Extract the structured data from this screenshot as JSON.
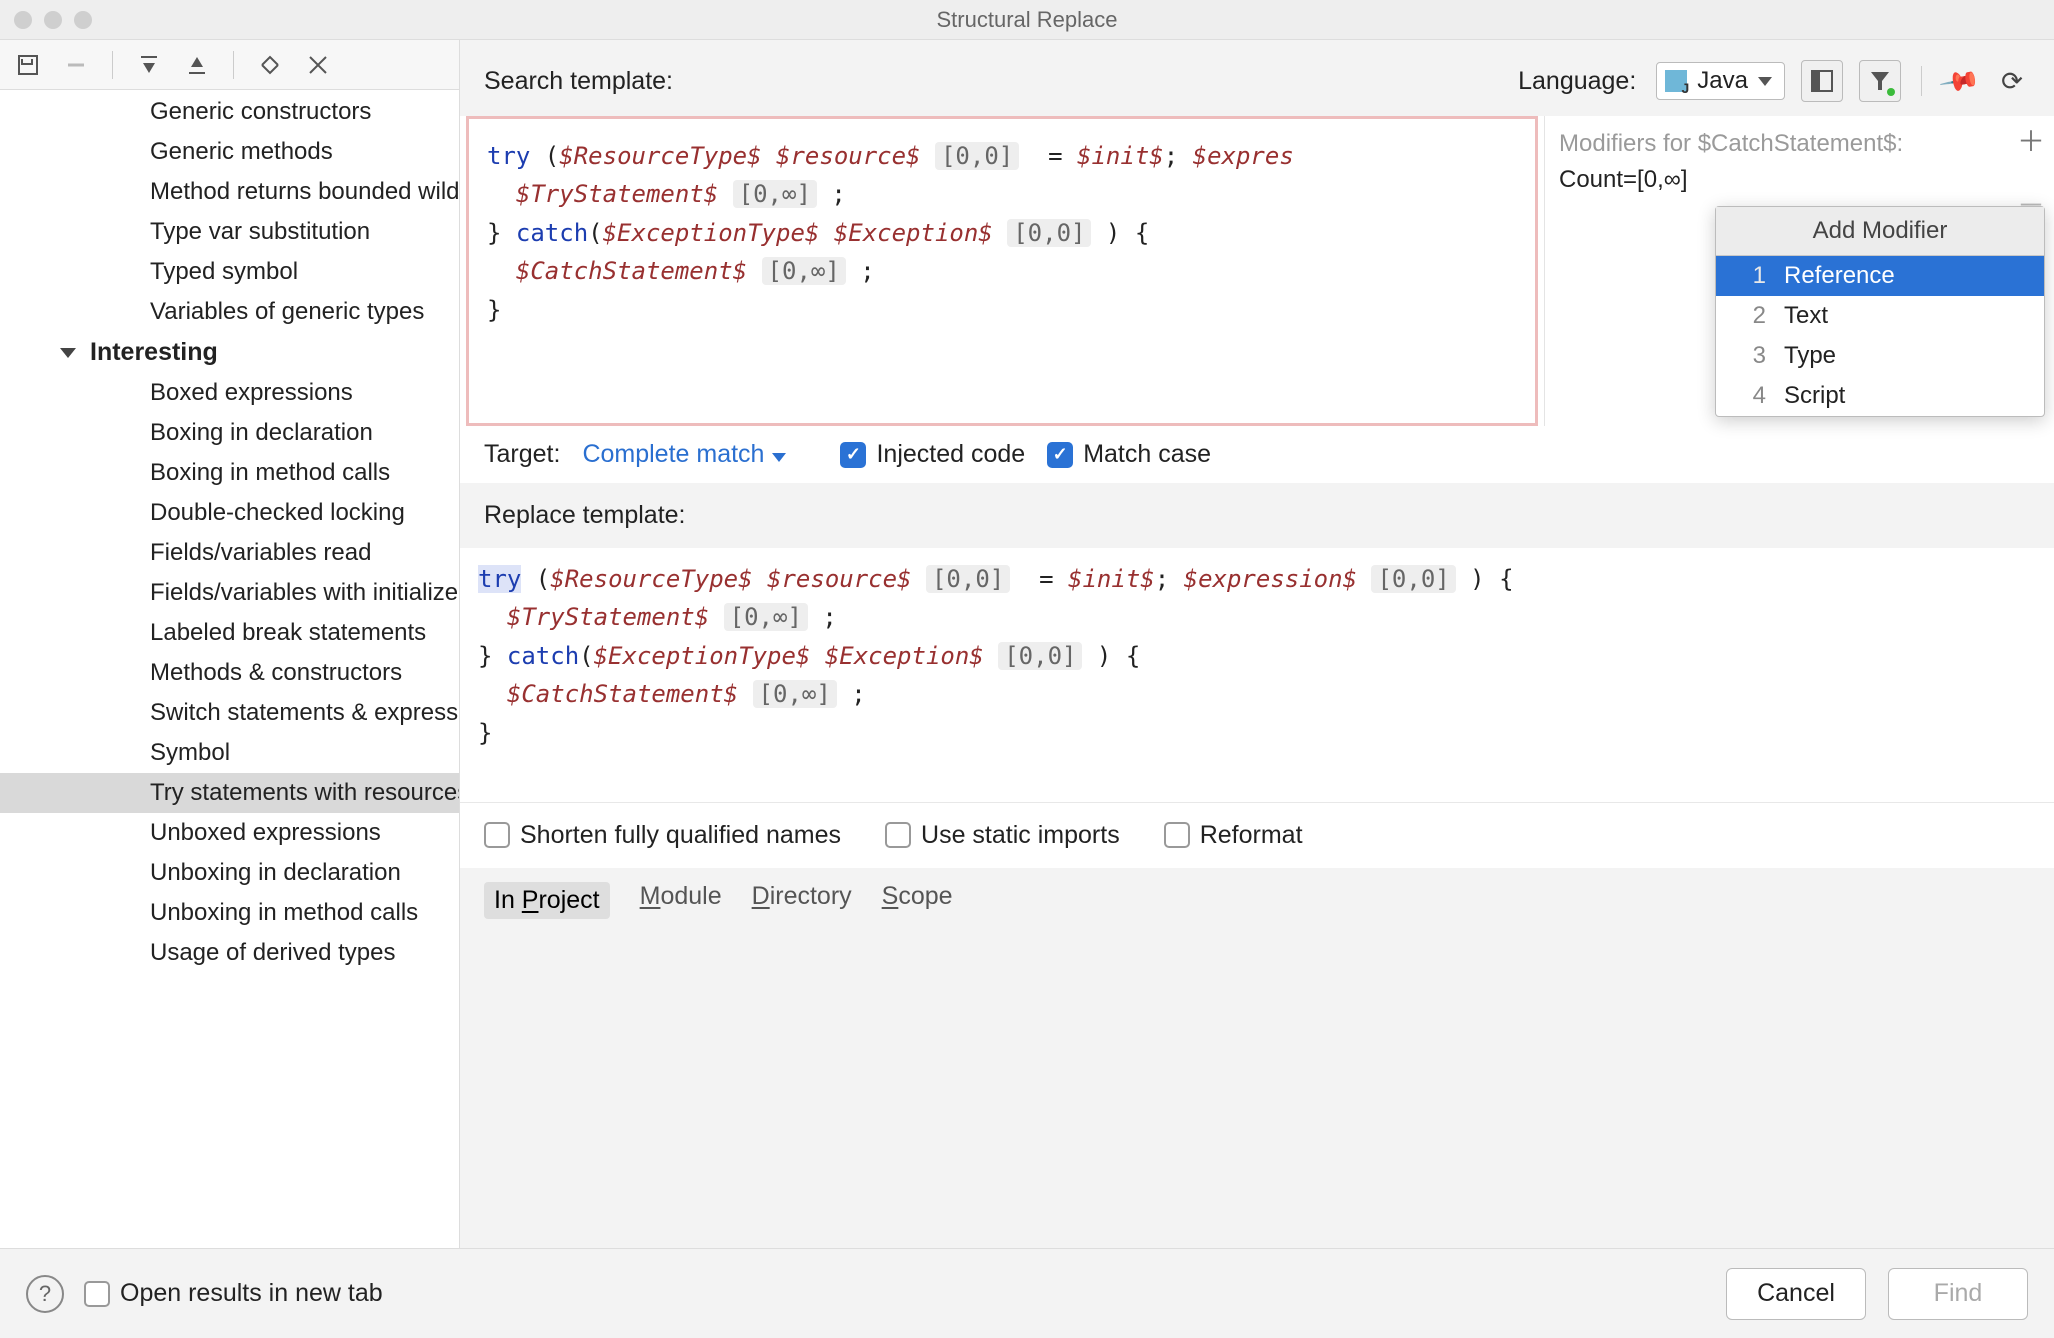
{
  "window": {
    "title": "Structural Replace"
  },
  "treeToolbar": {
    "saveIcon": "save-icon",
    "minusIcon": "minus-icon",
    "expandSelIcon": "expand-selection-icon",
    "collapseSelIcon": "collapse-selection-icon",
    "expandAllIcon": "expand-all-icon",
    "collapseAllIcon": "collapse-all-icon"
  },
  "tree": {
    "top": [
      "Generic constructors",
      "Generic methods",
      "Method returns bounded wildcard",
      "Type var substitution",
      "Typed symbol",
      "Variables of generic types"
    ],
    "groupLabel": "Interesting",
    "items": [
      "Boxed expressions",
      "Boxing in declaration",
      "Boxing in method calls",
      "Double-checked locking",
      "Fields/variables read",
      "Fields/variables with initializers",
      "Labeled break statements",
      "Methods & constructors",
      "Switch statements & expressions",
      "Symbol",
      "Try statements with resources",
      "Unboxed expressions",
      "Unboxing in declaration",
      "Unboxing in method calls",
      "Usage of derived types"
    ],
    "selectedIndex": 10
  },
  "search": {
    "label": "Search template:",
    "languageLabel": "Language:",
    "language": "Java",
    "code": {
      "try": "try",
      "openParen": " (",
      "resType": "$ResourceType$",
      "space1": " ",
      "resource": "$resource$",
      "tag00a": "[0,0]",
      "eq": "  = ",
      "init": "$init$",
      "semi1": "; ",
      "expr": "$expres",
      "line2_stmt": "$TryStatement$",
      "tag0inf1": "[0,∞]",
      "line2_end": " ;",
      "line3_open": "} ",
      "catch": "catch",
      "catchParen": "(",
      "excType": "$ExceptionType$",
      "exc": "$Exception$",
      "tag00b": "[0,0]",
      "line3_close": " ) {",
      "line4_stmt": "$CatchStatement$",
      "tag0inf2": "[0,∞]",
      "line4_semi": " ;",
      "closeBrace": "}"
    }
  },
  "mods": {
    "title": "Modifiers for $CatchStatement$:",
    "count": "Count=[0,∞]",
    "popupTitle": "Add Modifier",
    "options": [
      {
        "n": "1",
        "label": "Reference"
      },
      {
        "n": "2",
        "label": "Text"
      },
      {
        "n": "3",
        "label": "Type"
      },
      {
        "n": "4",
        "label": "Script"
      }
    ],
    "selected": 0
  },
  "target": {
    "label": "Target:",
    "value": "Complete match",
    "injected": "Injected code",
    "matchCase": "Match case"
  },
  "replace": {
    "label": "Replace template:",
    "code": {
      "try": "try",
      "openParen": " (",
      "resType": "$ResourceType$",
      "space1": " ",
      "resource": "$resource$",
      "tag00a": "[0,0]",
      "eq": "  = ",
      "init": "$init$",
      "semi1": "; ",
      "expr": "$expression$",
      "exprTag": "[0,0]",
      "exprClose": " ) {",
      "line2_stmt": "$TryStatement$",
      "tag0inf1": "[0,∞]",
      "line2_end": " ;",
      "line3_open": "} ",
      "catch": "catch",
      "catchParen": "(",
      "excType": "$ExceptionType$",
      "exc": "$Exception$",
      "tag00b": "[0,0]",
      "line3_close": " ) {",
      "line4_stmt": "$CatchStatement$",
      "tag0inf2": "[0,∞]",
      "line4_semi": " ;",
      "closeBrace": "}"
    }
  },
  "options3": {
    "shorten": "Shorten fully qualified names",
    "staticImports": "Use static imports",
    "reformat": "Reformat"
  },
  "scope": {
    "items": [
      {
        "label": "In Project",
        "ul": "P"
      },
      {
        "label": "Module",
        "ul": "M"
      },
      {
        "label": "Directory",
        "ul": "D"
      },
      {
        "label": "Scope",
        "ul": "S"
      }
    ],
    "active": 0
  },
  "footer": {
    "openResults": "Open results in new tab",
    "cancel": "Cancel",
    "find": "Find"
  }
}
